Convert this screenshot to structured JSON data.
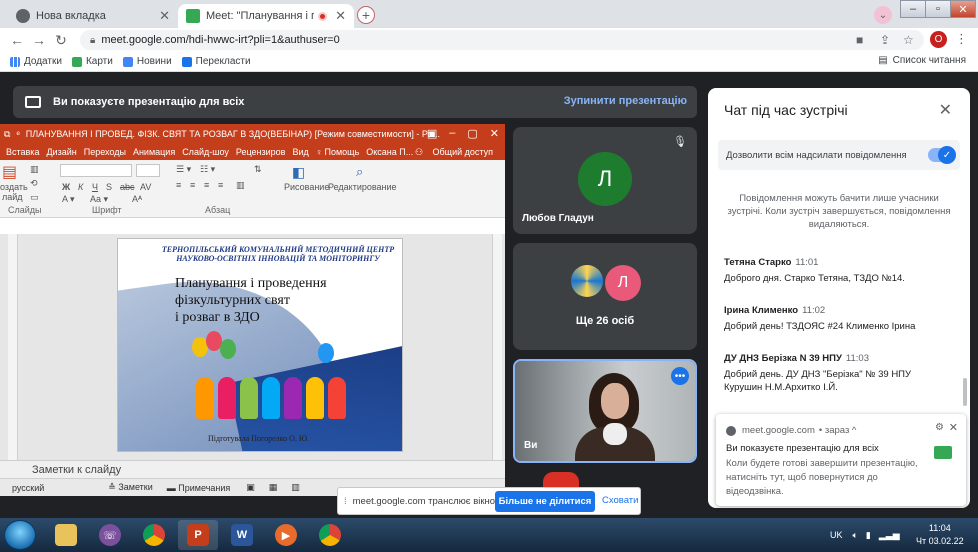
{
  "browser": {
    "tabs": [
      {
        "title": "Нова вкладка",
        "active": false
      },
      {
        "title": "Meet: \"Планування і прове...",
        "active": true
      }
    ],
    "url": "meet.google.com/hdi-hwwc-irt?pli=1&authuser=0",
    "profile_initial": "О",
    "bookmarks": [
      "Додатки",
      "Карти",
      "Новини",
      "Перекласти"
    ],
    "reading_list": "Список читання"
  },
  "meet": {
    "presenting_text": "Ви показуєте презентацію для всіх",
    "stop_presenting": "Зупинити презентацію",
    "tiles": [
      {
        "name": "Любов Гладун",
        "initial": "Л",
        "color": "#1e7c2f"
      },
      {
        "label": "Ще 26 осіб",
        "initial": "Л",
        "color": "#e8597a"
      },
      {
        "name": "Ви"
      }
    ]
  },
  "powerpoint": {
    "title": "ПЛАНУВАННЯ І ПРОВЕД. ФІЗК. СВЯТ ТА РОЗВАГ В ЗДО(ВЕБІНАР) [Режим совместимости] - Ро...",
    "ribbon_tabs": [
      "Вставка",
      "Дизайн",
      "Переходы",
      "Анимация",
      "Слайд-шоу",
      "Рецензиров",
      "Вид",
      "Помощь",
      "Оксана П...",
      "Общий доступ"
    ],
    "ribbon_groups": [
      "Слайды",
      "Шрифт",
      "Абзац",
      "Рисование",
      "Редактирование"
    ],
    "ribbon_left_labels": [
      "оздать",
      "лайд"
    ],
    "slide": {
      "header": "ТЕРНОПІЛЬСЬКИЙ КОМУНАЛЬНИЙ МЕТОДИЧНИЙ ЦЕНТР НАУКОВО-ОСВІТНІХ ІННОВАЦІЙ ТА МОНІТОРИНГУ",
      "title_lines": [
        "Планування і проведення",
        "фізкультурних свят",
        "і розваг в ЗДО"
      ],
      "author": "Підготувала Погорелко О. Ю."
    },
    "notes_placeholder": "Заметки к слайду",
    "status": {
      "language": "русский",
      "notes": "Заметки",
      "comments": "Примечания"
    }
  },
  "chat": {
    "title": "Чат під час зустрічі",
    "allow_label": "Дозволити всім надсилати повідомлення",
    "notice": "Повідомлення можуть бачити лише учасники зустрічі. Коли зустріч завершується, повідомлення видаляються.",
    "messages": [
      {
        "author": "Тетяна Старко",
        "time": "11:01",
        "text": "Доброго дня. Старко Тетяна, ТЗДО №14."
      },
      {
        "author": "Ірина Клименко",
        "time": "11:02",
        "text": "Добрий день! ТЗДОЯС #24 Клименко Ірина"
      },
      {
        "author": "ДУ ДНЗ Берізка N 39 НПУ",
        "time": "11:03",
        "text": "Добрий день. ДУ ДНЗ \"Берізка\" № 39 НПУ Курушин Н.М.Архитко І.Й."
      }
    ]
  },
  "toast": {
    "source": "meet.google.com",
    "when": "• зараз ^",
    "line1": "Ви показуєте презентацію для всіх",
    "line2": "Коли будете готові завершити презентацію, натисніть тут, щоб повернутися до відеодзвінка."
  },
  "share_bar": {
    "text": "meet.google.com транслює вікно.",
    "stop_button": "Більше не ділитися",
    "hide_button": "Сховати"
  },
  "taskbar": {
    "apps": [
      "file-explorer",
      "viber",
      "chrome",
      "powerpoint",
      "word",
      "media-player",
      "chrome"
    ],
    "lang": "UK",
    "time": "11:04",
    "date": "Чт 03.02.22"
  },
  "colors": {
    "ppt_accent": "#c43e1c",
    "meet_blue": "#1a73e8",
    "meet_dark": "#202124"
  }
}
